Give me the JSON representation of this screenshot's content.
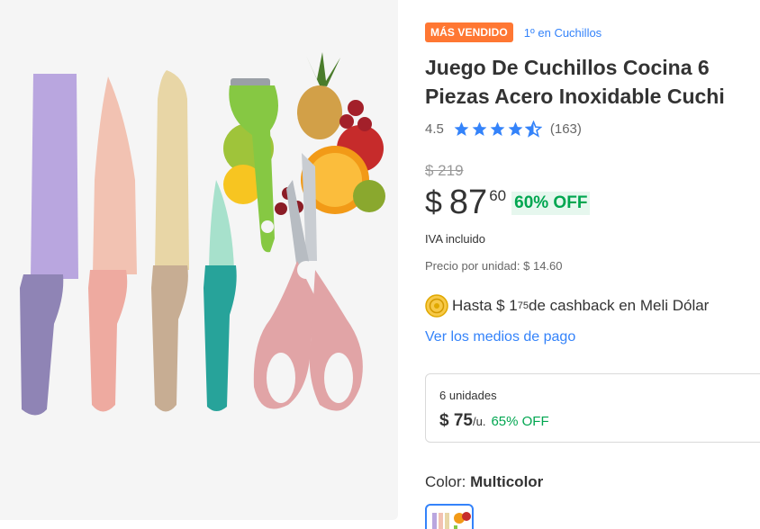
{
  "product": {
    "badge": "MÁS VENDIDO",
    "ranking": "1º en Cuchillos",
    "title_line1": "Juego De Cuchillos Cocina 6",
    "title_line2": "Piezas Acero Inoxidable Cuchi",
    "rating_value": "4.5",
    "rating_stars": 4.5,
    "review_count": "(163)",
    "original_price": "$ 219",
    "price_currency": "$",
    "price_integer": "87",
    "price_cents": "60",
    "discount": "60% OFF",
    "tax_note": "IVA incluido",
    "unit_price": "Precio por unidad: $ 14.60",
    "cashback_prefix": "Hasta $ 1",
    "cashback_cents": "75",
    "cashback_suffix": " de cashback en Meli Dólar",
    "payment_link": "Ver los medios de pago",
    "bundle": {
      "quantity": "6 unidades",
      "price": "$ 75",
      "per_unit": "/u.",
      "discount": "65% OFF"
    },
    "color_label": "Color: ",
    "color_value": "Multicolor"
  },
  "colors": {
    "accent": "#3483fa",
    "badge": "#ff7733",
    "green": "#00a650",
    "star": "#3483fa"
  }
}
